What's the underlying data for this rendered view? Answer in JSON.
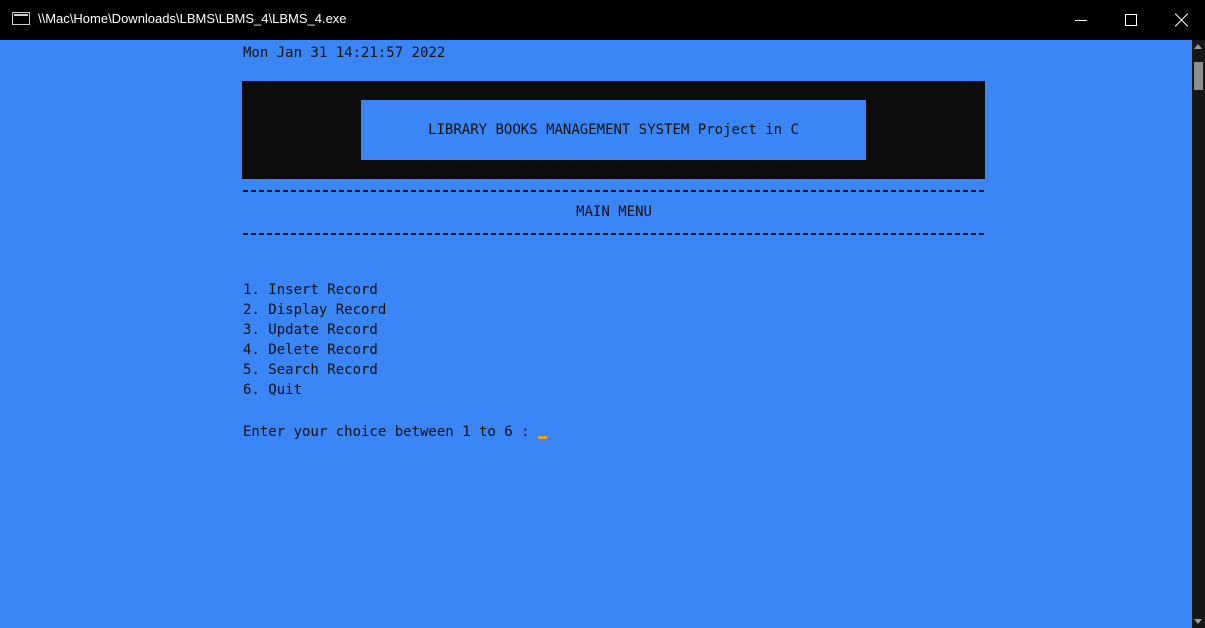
{
  "window": {
    "title": "\\\\Mac\\Home\\Downloads\\LBMS\\LBMS_4\\LBMS_4.exe",
    "icon": "console-app-icon",
    "controls": [
      "minimize-icon",
      "maximize-icon",
      "close-icon"
    ]
  },
  "console": {
    "timestamp": "Mon Jan 31 14:21:57 2022",
    "banner_title": "LIBRARY BOOKS MANAGEMENT SYSTEM Project in C",
    "menu_title": "MAIN MENU",
    "menu_items": [
      "1. Insert Record",
      "2. Display Record",
      "3. Update Record",
      "4. Delete Record",
      "5. Search Record",
      "6. Quit"
    ],
    "prompt": "Enter your choice between 1 to 6 : ",
    "input_value": ""
  },
  "colors": {
    "console_background": "#3a86f7",
    "banner_background": "#0c0c0c",
    "text": "#101010",
    "cursor": "#e7a21a",
    "titlebar": "#000000"
  }
}
